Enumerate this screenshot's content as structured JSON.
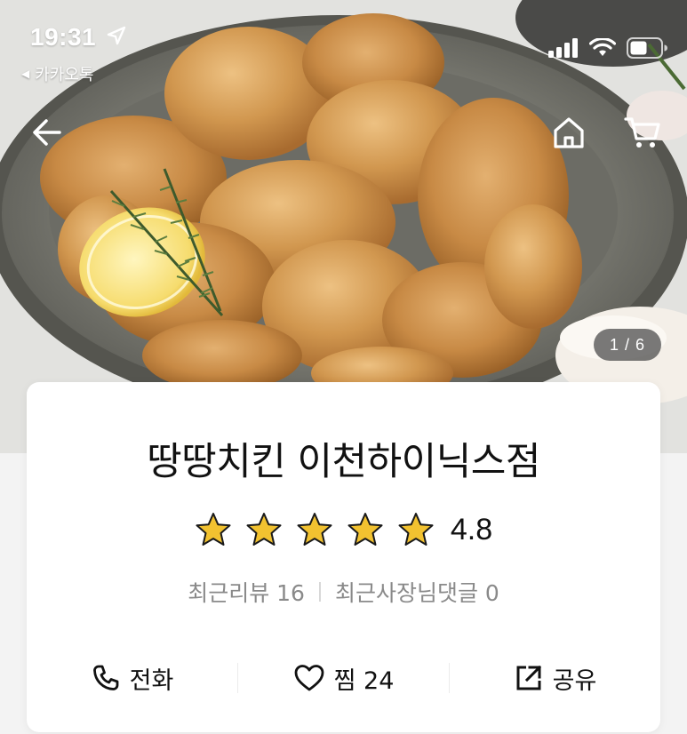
{
  "status_bar": {
    "time": "19:31",
    "back_app": "카카오톡",
    "icons": [
      "location-arrow-icon",
      "signal-icon",
      "wifi-icon",
      "battery-icon"
    ]
  },
  "nav": {
    "icons": [
      "back-arrow-icon",
      "home-icon",
      "cart-icon"
    ]
  },
  "gallery": {
    "counter": "1 / 6"
  },
  "store": {
    "name": "땅땅치킨 이천하이닉스점",
    "rating": "4.8",
    "stars": 5,
    "star_color": "#f2c230",
    "recent_reviews": "최근리뷰 16",
    "owner_replies": "최근사장님댓글 0"
  },
  "actions": {
    "call_label": "전화",
    "like_label": "찜 24",
    "share_label": "공유"
  }
}
